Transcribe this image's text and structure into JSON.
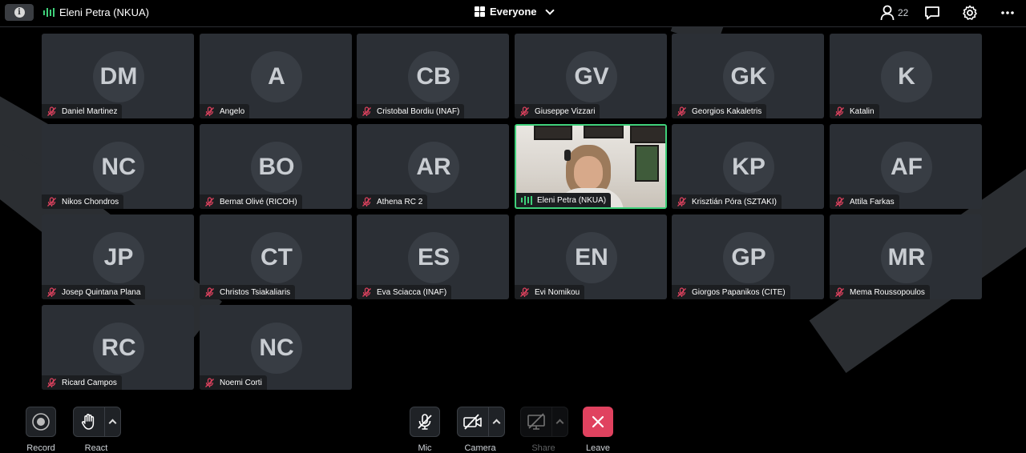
{
  "topbar": {
    "active_speaker": "Eleni Petra (NKUA)",
    "view_label": "Everyone",
    "participant_count": "22"
  },
  "tiles": [
    {
      "initials": "DM",
      "name": "Daniel Martinez",
      "video": false
    },
    {
      "initials": "A",
      "name": "Angelo",
      "video": false
    },
    {
      "initials": "CB",
      "name": "Cristobal Bordiu (INAF)",
      "video": false
    },
    {
      "initials": "GV",
      "name": "Giuseppe Vizzari",
      "video": false
    },
    {
      "initials": "GK",
      "name": "Georgios Kakaletris",
      "video": false
    },
    {
      "initials": "K",
      "name": "Katalin",
      "video": false
    },
    {
      "initials": "NC",
      "name": "Nikos Chondros",
      "video": false
    },
    {
      "initials": "BO",
      "name": "Bernat Olivé (RICOH)",
      "video": false
    },
    {
      "initials": "AR",
      "name": "Athena RC 2",
      "video": false
    },
    {
      "initials": "",
      "name": "Eleni Petra (NKUA)",
      "video": true
    },
    {
      "initials": "KP",
      "name": "Krisztián Póra (SZTAKI)",
      "video": false
    },
    {
      "initials": "AF",
      "name": "Attila Farkas",
      "video": false
    },
    {
      "initials": "JP",
      "name": "Josep Quintana Plana",
      "video": false
    },
    {
      "initials": "CT",
      "name": "Christos Tsiakaliaris",
      "video": false
    },
    {
      "initials": "ES",
      "name": "Eva Sciacca (INAF)",
      "video": false
    },
    {
      "initials": "EN",
      "name": "Evi Nomikou",
      "video": false
    },
    {
      "initials": "GP",
      "name": "Giorgos Papanikos (CITE)",
      "video": false
    },
    {
      "initials": "MR",
      "name": "Mema Roussopoulos",
      "video": false
    },
    {
      "initials": "RC",
      "name": "Ricard Campos",
      "video": false
    },
    {
      "initials": "NC",
      "name": "Noemi Corti",
      "video": false
    }
  ],
  "controls": {
    "record": "Record",
    "react": "React",
    "mic": "Mic",
    "camera": "Camera",
    "share": "Share",
    "leave": "Leave"
  },
  "colors": {
    "speaking_green": "#3fd07a",
    "muted_red": "#e0425f",
    "tile_bg": "#2b2f35"
  }
}
